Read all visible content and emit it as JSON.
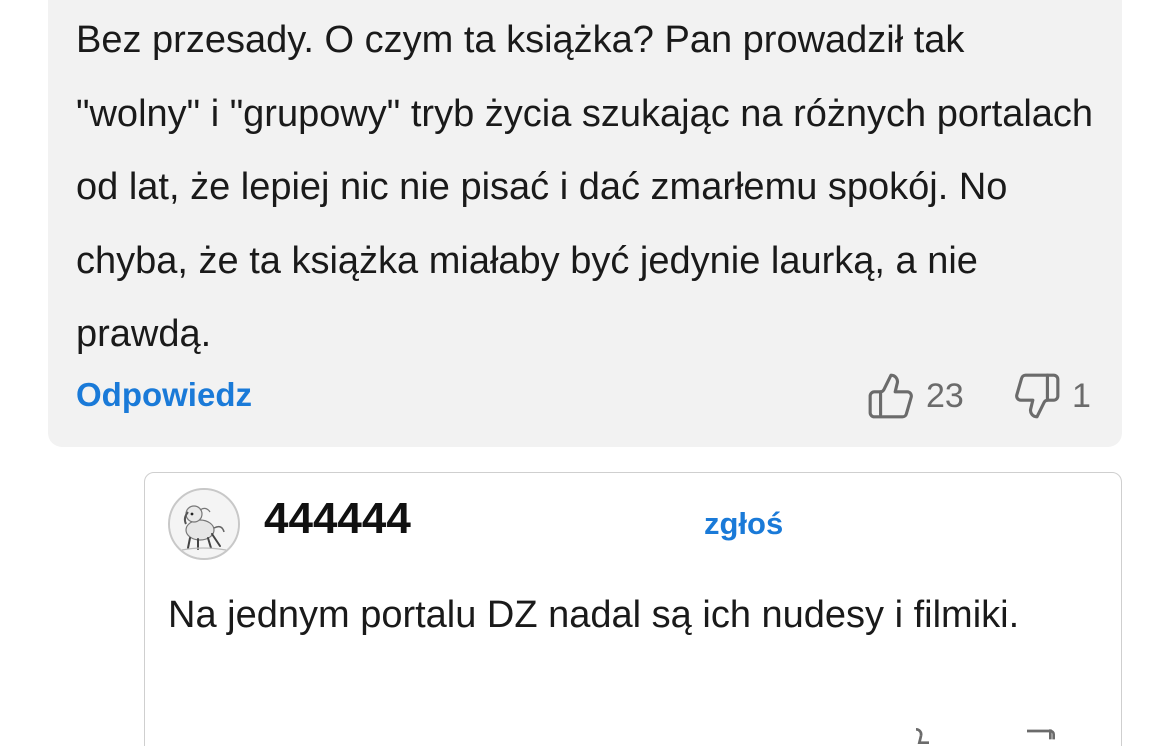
{
  "comment": {
    "text": "Bez przesady. O czym ta książka? Pan prowadził tak \"wolny\" i \"grupowy\" tryb życia szukając na różnych portalach od lat, że lepiej nic nie pisać i dać zmarłemu spokój. No chyba, że ta książka miałaby być jedynie laurką, a nie prawdą.",
    "reply_label": "Odpowiedz",
    "likes": "23",
    "dislikes": "1",
    "like_icon": "thumbs-up-icon",
    "dislike_icon": "thumbs-down-icon"
  },
  "reply": {
    "username": "444444",
    "report_label": "zgłoś",
    "text": "Na jednym portalu DZ nadal są ich nudesy i filmiki.",
    "avatar_icon": "avatar-dog-icon"
  },
  "colors": {
    "accent": "#1a7ad8",
    "card_background": "#f2f2f2",
    "muted": "#6b6b6b"
  }
}
